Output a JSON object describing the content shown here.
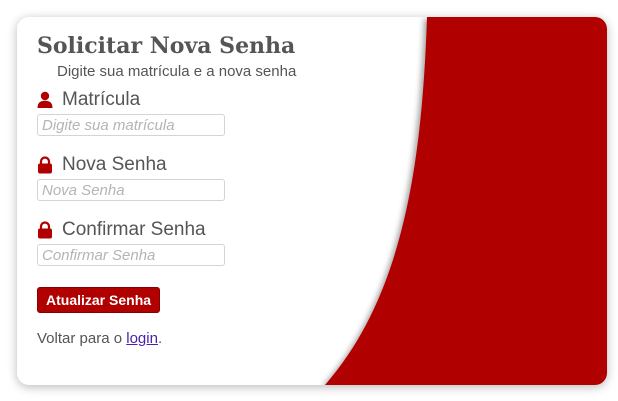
{
  "form": {
    "title": "Solicitar Nova Senha",
    "subtitle": "Digite sua matrícula e a nova senha",
    "fields": [
      {
        "label": "Matrícula",
        "placeholder": "Digite sua matrícula",
        "icon": "user-icon"
      },
      {
        "label": "Nova Senha",
        "placeholder": "Nova Senha",
        "icon": "lock-icon"
      },
      {
        "label": "Confirmar Senha",
        "placeholder": "Confirmar Senha",
        "icon": "lock-icon"
      }
    ],
    "submit_label": "Atualizar Senha",
    "back_prefix": "Voltar para o ",
    "back_link": "login",
    "back_suffix": "."
  },
  "colors": {
    "accent": "#b00000",
    "text": "#555555",
    "link": "#4b1fa8"
  }
}
